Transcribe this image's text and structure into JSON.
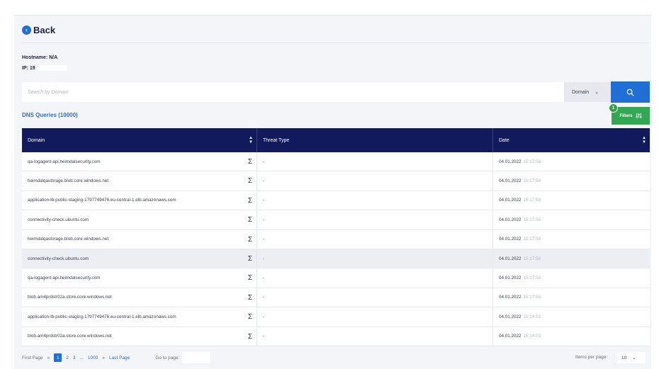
{
  "back": {
    "label": "Back"
  },
  "host_info": {
    "hostname": "Hostname: N/A",
    "ip": "IP: 19"
  },
  "search": {
    "placeholder": "Search by Domain",
    "filter_field": "Domain"
  },
  "dns": {
    "count_label": "DNS Queries (10000)"
  },
  "filters": {
    "label": "Filters",
    "badge": "1"
  },
  "table": {
    "headers": [
      "Domain",
      "Threat Type",
      "Date"
    ],
    "rows": [
      {
        "domain": "qa-logagent-api.heimdalsecurity.com",
        "threat": "-",
        "date": "04.01.2022",
        "time": "15:17:58"
      },
      {
        "domain": "heimdalqastorage.blob.core.windows.net",
        "threat": "-",
        "date": "04.01.2022",
        "time": "15:17:58"
      },
      {
        "domain": "application-lb-public-staging-1797749476.eu-central-1.elb.amazonaws.com",
        "threat": "-",
        "date": "04.01.2022",
        "time": "15:17:58"
      },
      {
        "domain": "connectivity-check.ubuntu.com",
        "threat": "-",
        "date": "04.01.2022",
        "time": "15:17:58"
      },
      {
        "domain": "heimdalqastorage.blob.core.windows.net",
        "threat": "-",
        "date": "04.01.2022",
        "time": "15:17:58"
      },
      {
        "domain": "connectivity-check.ubuntu.com",
        "threat": "-",
        "date": "04.01.2022",
        "time": "15:17:58"
      },
      {
        "domain": "qa-logagent-api.heimdalsecurity.com",
        "threat": "-",
        "date": "04.01.2022",
        "time": "15:17:58"
      },
      {
        "domain": "blob.am4prdstr02a.store.core.windows.net",
        "threat": "-",
        "date": "04.01.2022",
        "time": "15:17:58"
      },
      {
        "domain": "application-lb-public-staging-1797749476.eu-central-1.elb.amazonaws.com",
        "threat": "-",
        "date": "04.01.2022",
        "time": "15:14:03"
      },
      {
        "domain": "blob.am4prdstr02a.store.core.windows.net",
        "threat": "-",
        "date": "04.01.2022",
        "time": "15:14:03"
      }
    ]
  },
  "pagination": {
    "first": "First Page",
    "prev": "«",
    "pages": [
      "1",
      "2",
      "3"
    ],
    "ellipsis": "...",
    "last_number": "1000",
    "next": "»",
    "last": "Last Page",
    "goto_label": "Go to page:",
    "items_per_page_label": "Items per page:",
    "items_per_page": "10"
  },
  "colors": {
    "accent": "#1f6fd6",
    "header": "#101a5c",
    "filters": "#33a852"
  },
  "icons": {
    "back": "chevron-left-circle-icon",
    "search": "search-icon",
    "filters": "sliders-icon",
    "sort": "sort-icon",
    "sigma": "sigma-icon"
  }
}
